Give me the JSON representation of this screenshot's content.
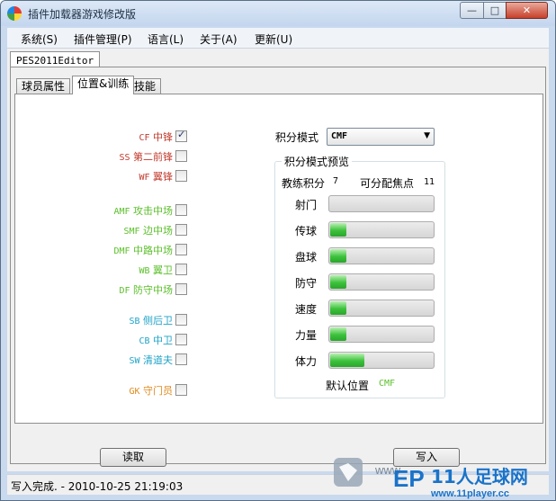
{
  "window": {
    "title": "插件加载器游戏修改版"
  },
  "menu": [
    "系统(S)",
    "插件管理(P)",
    "语言(L)",
    "关于(A)",
    "更新(U)"
  ],
  "outer_tab": "PES2011Editor",
  "inner_tabs": [
    "球员属性",
    "位置&训练",
    "技能"
  ],
  "positions": [
    {
      "code": "CF",
      "name": "中锋",
      "checked": true,
      "color": "#c0392b"
    },
    {
      "code": "SS",
      "name": "第二前锋",
      "checked": false,
      "color": "#c0392b"
    },
    {
      "code": "WF",
      "name": "翼锋",
      "checked": false,
      "color": "#c0392b"
    },
    {
      "code": "AMF",
      "name": "攻击中场",
      "checked": false,
      "color": "#5bbf2a"
    },
    {
      "code": "SMF",
      "name": "边中场",
      "checked": false,
      "color": "#5bbf2a"
    },
    {
      "code": "DMF",
      "name": "中路中场",
      "checked": false,
      "color": "#5bbf2a"
    },
    {
      "code": "WB",
      "name": "翼卫",
      "checked": false,
      "color": "#5bbf2a"
    },
    {
      "code": "DF",
      "name": "防守中场",
      "checked": false,
      "color": "#5bbf2a"
    },
    {
      "code": "SB",
      "name": "侧后卫",
      "checked": false,
      "color": "#1fa3c7"
    },
    {
      "code": "CB",
      "name": "中卫",
      "checked": false,
      "color": "#1fa3c7"
    },
    {
      "code": "SW",
      "name": "清道夫",
      "checked": false,
      "color": "#1fa3c7"
    },
    {
      "code": "GK",
      "name": "守门员",
      "checked": false,
      "color": "#e08a1e"
    }
  ],
  "scoring": {
    "mode_label": "积分模式",
    "mode_value": "CMF",
    "preview_title": "积分模式预览",
    "coach_label": "教练积分",
    "coach_value": "7",
    "alloc_label": "可分配焦点",
    "alloc_value": "11",
    "stats": [
      {
        "label": "射门",
        "level": 0.0
      },
      {
        "label": "传球",
        "level": 0.16
      },
      {
        "label": "盘球",
        "level": 0.16
      },
      {
        "label": "防守",
        "level": 0.16
      },
      {
        "label": "速度",
        "level": 0.16
      },
      {
        "label": "力量",
        "level": 0.16
      },
      {
        "label": "体力",
        "level": 0.33
      }
    ],
    "default_pos_label": "默认位置",
    "default_pos_value": "CMF"
  },
  "buttons": {
    "read": "读取",
    "write": "写入"
  },
  "status": "写入完成. - 2010-10-25 21:19:03",
  "watermark": {
    "ep": "EP",
    "site": "11人足球网",
    "url": "www.11player.cc",
    "prefix": "www"
  }
}
